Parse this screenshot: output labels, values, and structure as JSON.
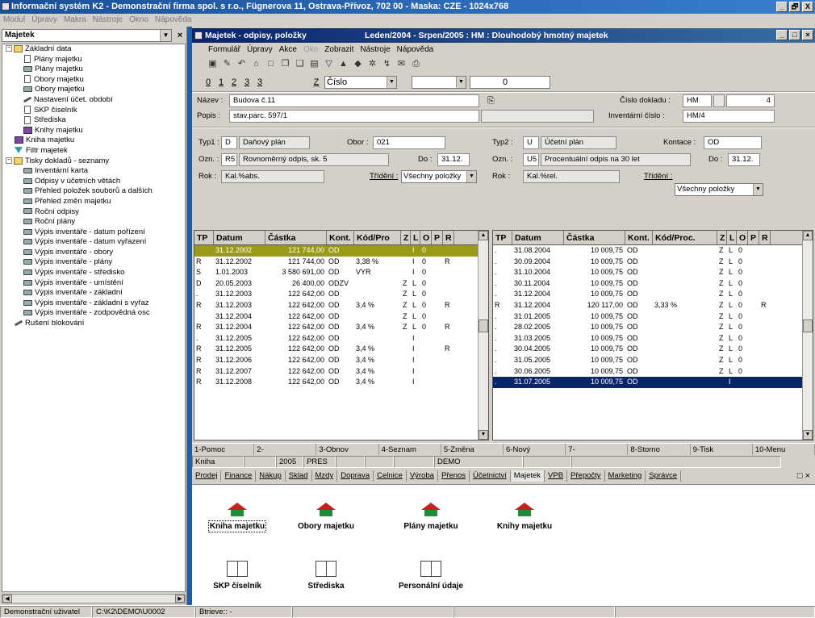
{
  "app": {
    "title": "Informační systém K2 - Demonstrační firma spol. s r.o., Fügnerova 11, Ostrava-Přívoz, 702 00 - Maska: CZE - 1024x768",
    "window_buttons": [
      "_",
      "🗗",
      "X"
    ]
  },
  "main_menu": [
    "Modul",
    "Úpravy",
    "Makra",
    "Nástroje",
    "Okno",
    "Nápověda"
  ],
  "left_panel": {
    "selector": "Majetek",
    "close": "×",
    "tree": [
      {
        "label": "Základní data",
        "icon": "folder-icon",
        "level": 0,
        "expander": "−"
      },
      {
        "label": "Plány majetku",
        "icon": "page-icon",
        "level": 2
      },
      {
        "label": "Plány majetku",
        "icon": "printer-icon",
        "level": 2
      },
      {
        "label": "Obory majetku",
        "icon": "page-icon",
        "level": 2
      },
      {
        "label": "Obory majetku",
        "icon": "printer-icon",
        "level": 2
      },
      {
        "label": "Nastavení účet. období",
        "icon": "tools-icon",
        "level": 2
      },
      {
        "label": "SKP číselník",
        "icon": "page-icon",
        "level": 2
      },
      {
        "label": "Střediska",
        "icon": "page-icon",
        "level": 2
      },
      {
        "label": "Knihy majetku",
        "icon": "book-icon",
        "level": 2
      },
      {
        "label": "Kniha majetku",
        "icon": "book-icon",
        "level": 1
      },
      {
        "label": "Filtr majetek",
        "icon": "filter-icon",
        "level": 1
      },
      {
        "label": "Tisky dokladů - seznamy",
        "icon": "folder-icon",
        "level": 0,
        "expander": "−"
      },
      {
        "label": "Inventární karta",
        "icon": "printer-icon",
        "level": 2
      },
      {
        "label": "Odpisy v účetních větách",
        "icon": "printer-icon",
        "level": 2
      },
      {
        "label": "Přehled položek souborů a dalších",
        "icon": "printer-icon",
        "level": 2
      },
      {
        "label": "Přehled změn majetku",
        "icon": "printer-icon",
        "level": 2
      },
      {
        "label": "Roční odpisy",
        "icon": "printer-icon",
        "level": 2
      },
      {
        "label": "Roční plány",
        "icon": "printer-icon",
        "level": 2
      },
      {
        "label": "Výpis inventáře - datum pořízení",
        "icon": "printer-icon",
        "level": 2
      },
      {
        "label": "Výpis inventáře - datum vyřazení",
        "icon": "printer-icon",
        "level": 2
      },
      {
        "label": "Výpis inventáře - obory",
        "icon": "printer-icon",
        "level": 2
      },
      {
        "label": "Výpis inventáře - plány",
        "icon": "printer-icon",
        "level": 2
      },
      {
        "label": "Výpis inventáře - středisko",
        "icon": "printer-icon",
        "level": 2
      },
      {
        "label": "Výpis inventáře - umístění",
        "icon": "printer-icon",
        "level": 2
      },
      {
        "label": "Výpis inventáře - základní",
        "icon": "printer-icon",
        "level": 2
      },
      {
        "label": "Výpis inventáře - základní s vyřaz",
        "icon": "printer-icon",
        "level": 2
      },
      {
        "label": "Výpis inventáře - zodpovědná osc",
        "icon": "printer-icon",
        "level": 2
      },
      {
        "label": "Rušení blokování",
        "icon": "tools-icon",
        "level": 1
      }
    ]
  },
  "child": {
    "title": "Majetek - odpisy, položky",
    "subtitle": "Leden/2004 - Srpen/2005 : HM : Dlouhodobý hmotný majetek",
    "menu": [
      {
        "label": "Formulář",
        "disabled": false
      },
      {
        "label": "Úpravy",
        "disabled": false
      },
      {
        "label": "Akce",
        "disabled": false
      },
      {
        "label": "Oko",
        "disabled": true
      },
      {
        "label": "Zobrazit",
        "disabled": false
      },
      {
        "label": "Nástroje",
        "disabled": false
      },
      {
        "label": "Nápověda",
        "disabled": false
      }
    ],
    "toolbar": [
      {
        "name": "save-icon",
        "glyph": "▣"
      },
      {
        "name": "edit-icon",
        "glyph": "✎"
      },
      {
        "name": "undo-icon",
        "glyph": "↶"
      },
      {
        "name": "open-icon",
        "glyph": "⌂"
      },
      {
        "name": "new-icon",
        "glyph": "□"
      },
      {
        "name": "copy-icon",
        "glyph": "❐"
      },
      {
        "name": "paste-icon",
        "glyph": "❏"
      },
      {
        "name": "book-icon",
        "glyph": "▤"
      },
      {
        "name": "filter-icon",
        "glyph": "▽"
      },
      {
        "name": "up-icon",
        "glyph": "▲"
      },
      {
        "name": "down-icon",
        "glyph": "◆"
      },
      {
        "name": "tools-icon",
        "glyph": "✲"
      },
      {
        "name": "signal-icon",
        "glyph": "↯"
      },
      {
        "name": "mail-icon",
        "glyph": "✉"
      },
      {
        "name": "print-icon",
        "glyph": "⎙"
      }
    ],
    "pages": [
      "0",
      "1",
      "2",
      "3",
      "3"
    ],
    "sort_key": "Z",
    "sort_field": "Číslo",
    "search_value": "0",
    "header": {
      "nazev_label": "Název :",
      "nazev": "Budova č.11",
      "popis_label": "Popis :",
      "popis": "stav.parc. 597/1",
      "cislo_dokladu_label": "Číslo dokladu :",
      "doklad_rada": "HM",
      "doklad_cislo": "4",
      "inv_cislo_label": "Inventární číslo :",
      "inv_cislo": "HM/4"
    },
    "left_plan": {
      "typ_label": "Typ1 :",
      "typ": "D",
      "typ_text": "Daňový plán",
      "obor_label": "Obor :",
      "obor": "021",
      "ozn_label": "Ozn. :",
      "ozn": "R5",
      "ozn_text": "Rovnoměrný odpis, sk. 5",
      "do_label": "Do :",
      "do": "31.12.",
      "rok_label": "Rok :",
      "rok": "Kal.%abs.",
      "trideni_label": "Třídění :",
      "trideni": "Všechny položky"
    },
    "right_plan": {
      "typ_label": "Typ2 :",
      "typ": "U",
      "typ_text": "Účetní plán",
      "kontace_label": "Kontace :",
      "kontace": "OD",
      "ozn_label": "Ozn. :",
      "ozn": "U5",
      "ozn_text": "Procentuální odpis na 30 let",
      "do_label": "Do :",
      "do": "31.12.",
      "rok_label": "Rok :",
      "rok": "Kal.%rel.",
      "trideni_label": "Třídění :",
      "trideni": "Všechny položky"
    },
    "left_grid": {
      "columns": [
        "TP",
        "Datum",
        "Částka",
        "Kont.",
        "Kód/Pro",
        "Z",
        "L",
        "O",
        "P",
        "R"
      ],
      "rows": [
        [
          "",
          "31.12.2002",
          "121 744,00",
          "OD",
          "",
          "",
          "I",
          "0",
          "",
          ""
        ],
        [
          "R",
          "31.12.2002",
          "121 744,00",
          "OD",
          "3,38 %",
          "",
          "I",
          "0",
          "",
          "R"
        ],
        [
          "S",
          "1.01.2003",
          "3 580 691,00",
          "OD",
          "VYR",
          "",
          "I",
          "0",
          "",
          ""
        ],
        [
          "D",
          "20.05.2003",
          "26 400,00",
          "ODZV",
          "",
          "Z",
          "L",
          "0",
          "",
          ""
        ],
        [
          ".",
          "31.12.2003",
          "122 642,00",
          "OD",
          "",
          "Z",
          "L",
          "0",
          "",
          ""
        ],
        [
          "R",
          "31.12.2003",
          "122 642,00",
          "OD",
          "3,4 %",
          "Z",
          "L",
          "0",
          "",
          "R"
        ],
        [
          "",
          "31.12.2004",
          "122 642,00",
          "OD",
          "",
          "Z",
          "L",
          "0",
          "",
          ""
        ],
        [
          "R",
          "31.12.2004",
          "122 642,00",
          "OD",
          "3,4 %",
          "Z",
          "L",
          "0",
          "",
          "R"
        ],
        [
          ".",
          "31.12.2005",
          "122 642,00",
          "OD",
          "",
          "",
          "I",
          "",
          "",
          ""
        ],
        [
          "R",
          "31.12.2005",
          "122 642,00",
          "OD",
          "3,4 %",
          "",
          "I",
          "",
          "",
          "R"
        ],
        [
          "R",
          "31.12.2006",
          "122 642,00",
          "OD",
          "3,4 %",
          "",
          "I",
          "",
          "",
          ""
        ],
        [
          "R",
          "31.12.2007",
          "122 642,00",
          "OD",
          "3,4 %",
          "",
          "I",
          "",
          "",
          ""
        ],
        [
          "R",
          "31.12.2008",
          "122 642,00",
          "OD",
          "3,4 %",
          "",
          "I",
          "",
          "",
          ""
        ]
      ]
    },
    "right_grid": {
      "columns": [
        "TP",
        "Datum",
        "Částka",
        "Kont.",
        "Kód/Proc.",
        "Z",
        "L",
        "O",
        "P",
        "R"
      ],
      "rows": [
        [
          ".",
          "31.08.2004",
          "10 009,75",
          "OD",
          "",
          "Z",
          "L",
          "0",
          "",
          ""
        ],
        [
          ".",
          "30.09.2004",
          "10 009,75",
          "OD",
          "",
          "Z",
          "L",
          "0",
          "",
          ""
        ],
        [
          ".",
          "31.10.2004",
          "10 009,75",
          "OD",
          "",
          "Z",
          "L",
          "0",
          "",
          ""
        ],
        [
          ".",
          "30.11.2004",
          "10 009,75",
          "OD",
          "",
          "Z",
          "L",
          "0",
          "",
          ""
        ],
        [
          ".",
          "31.12.2004",
          "10 009,75",
          "OD",
          "",
          "Z",
          "L",
          "0",
          "",
          ""
        ],
        [
          "R",
          "31.12.2004",
          "120 117,00",
          "OD",
          "3,33 %",
          "Z",
          "L",
          "0",
          "",
          "R"
        ],
        [
          ".",
          "31.01.2005",
          "10 009,75",
          "OD",
          "",
          "Z",
          "L",
          "0",
          "",
          ""
        ],
        [
          ".",
          "28.02.2005",
          "10 009,75",
          "OD",
          "",
          "Z",
          "L",
          "0",
          "",
          ""
        ],
        [
          ".",
          "31.03.2005",
          "10 009,75",
          "OD",
          "",
          "Z",
          "L",
          "0",
          "",
          ""
        ],
        [
          ".",
          "30.04.2005",
          "10 009,75",
          "OD",
          "",
          "Z",
          "L",
          "0",
          "",
          ""
        ],
        [
          ".",
          "31.05.2005",
          "10 009,75",
          "OD",
          "",
          "Z",
          "L",
          "0",
          "",
          ""
        ],
        [
          ".",
          "30.06.2005",
          "10 009,75",
          "OD",
          "",
          "Z",
          "L",
          "0",
          "",
          ""
        ],
        [
          ".",
          "31.07.2005",
          "10 009,75",
          "OD",
          "",
          "",
          "I",
          "",
          "",
          ""
        ]
      ]
    },
    "fkeys": [
      "1-Pomoc",
      "2-",
      "3-Obnov",
      "4-Seznam",
      "5-Změna",
      "6-Nový",
      "7-",
      "8-Storno",
      "9-Tisk",
      "10-Menu"
    ],
    "status": [
      "Kniha",
      "",
      "2005",
      "PRES",
      "",
      "",
      "",
      "DEMO",
      "",
      ""
    ],
    "module_tabs": [
      "Prodej",
      "Finance",
      "Nákup",
      "Sklad",
      "Mzdy",
      "Doprava",
      "Celnice",
      "Výroba",
      "Přenos",
      "Účetnictví",
      "Majetek",
      "VPB",
      "Přepočty",
      "Marketing",
      "Správce"
    ],
    "active_tab": "Majetek",
    "tab_controls": "□ ×",
    "desktop_icons": [
      {
        "label": "Kniha majetku",
        "icon": "house-icon"
      },
      {
        "label": "Obory majetku",
        "icon": "house-icon"
      },
      {
        "label": "Plány majetku",
        "icon": "house-icon"
      },
      {
        "label": "Knihy majetku",
        "icon": "house-icon"
      },
      {
        "label": "SKP číselník",
        "icon": "book-icon"
      },
      {
        "label": "Střediska",
        "icon": "book-icon"
      },
      {
        "label": "Personální údaje",
        "icon": "book-icon"
      }
    ]
  },
  "bottom_status": [
    "Demonstrační uživatel",
    "C:\\K2\\DEMO\\U0002",
    "Btrieve:: -",
    "",
    "",
    ""
  ]
}
